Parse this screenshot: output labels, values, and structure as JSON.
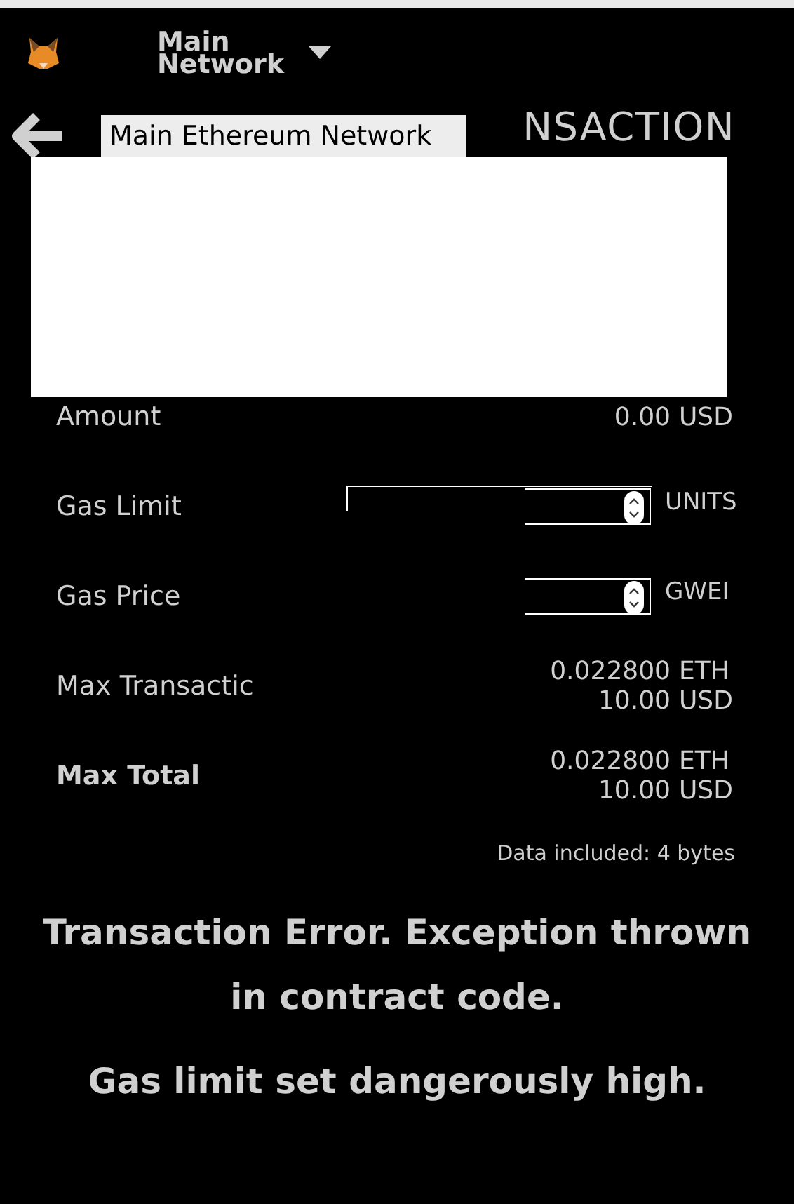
{
  "header": {
    "network": "Main Network"
  },
  "tooltip": "Main Ethereum Network",
  "title": "NSACTION",
  "rows": [
    {
      "kind": "amount",
      "label": "Amount",
      "bold": false,
      "lines": [
        {
          "value": "0.00",
          "unit": "USD"
        }
      ]
    },
    {
      "kind": "input",
      "label": "Gas Limit",
      "bold": false,
      "unit": "UNITS",
      "wide": true
    },
    {
      "kind": "input",
      "label": "Gas Price",
      "bold": false,
      "unit": "GWEI",
      "wide": false
    },
    {
      "kind": "amount",
      "label": "Max Transactic",
      "bold": false,
      "lines": [
        {
          "value": "0.022800",
          "unit": "ETH"
        },
        {
          "value": "10.00",
          "unit": "USD"
        }
      ]
    },
    {
      "kind": "amount",
      "label": "Max Total",
      "bold": true,
      "lines": [
        {
          "value": "0.022800",
          "unit": "ETH"
        },
        {
          "value": "10.00",
          "unit": "USD"
        }
      ]
    }
  ],
  "data_note": "Data included: 4 bytes",
  "errors": [
    "Transaction Error. Exception thrown in contract code.",
    "Gas limit set dangerously high."
  ]
}
